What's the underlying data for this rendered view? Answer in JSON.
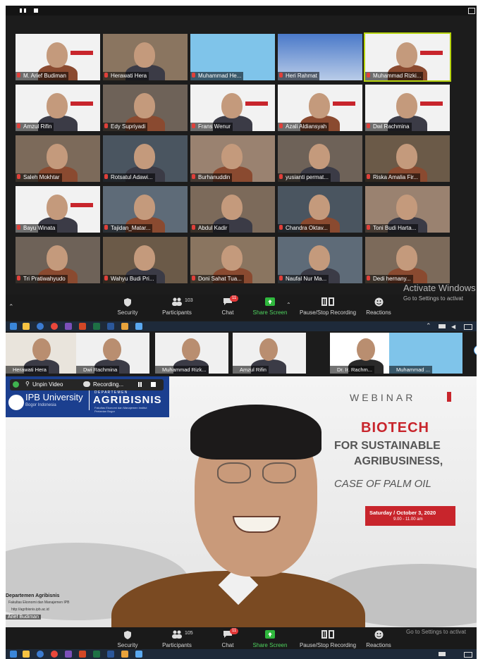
{
  "top_window": {
    "participants": [
      {
        "name": "M. Arief Budiman",
        "type": "slide"
      },
      {
        "name": "Herawati Hera",
        "type": "person"
      },
      {
        "name": "Muhammad He...",
        "type": "blank"
      },
      {
        "name": "Heri Rahmat",
        "type": "logo"
      },
      {
        "name": "Muhammad Rizki...",
        "type": "slide",
        "active": true
      },
      {
        "name": "Amzul Rifin",
        "type": "slide"
      },
      {
        "name": "Edy Supriyadi",
        "type": "person"
      },
      {
        "name": "Frans Wenur",
        "type": "slide"
      },
      {
        "name": "Azali Aldiansyah",
        "type": "slide"
      },
      {
        "name": "Dwi Rachmina",
        "type": "slide"
      },
      {
        "name": "Saleh Mokhtar",
        "type": "person"
      },
      {
        "name": "Rotsatul Adawi...",
        "type": "person"
      },
      {
        "name": "Burhanuddin",
        "type": "person"
      },
      {
        "name": "yusianti permat...",
        "type": "person"
      },
      {
        "name": "Riska Amalia Fir...",
        "type": "person"
      },
      {
        "name": "Bayu Winata",
        "type": "slide"
      },
      {
        "name": "Tajidan_Matar...",
        "type": "person"
      },
      {
        "name": "Abdul Kadir",
        "type": "person"
      },
      {
        "name": "Chandra Oktav...",
        "type": "person"
      },
      {
        "name": "Toni Budi Harta...",
        "type": "person"
      },
      {
        "name": "Tri Pratiwahyudo",
        "type": "person"
      },
      {
        "name": "Wahyu Budi Pri...",
        "type": "person"
      },
      {
        "name": "Doni Sahat Tua...",
        "type": "person"
      },
      {
        "name": "Naufal Nur Ma...",
        "type": "person"
      },
      {
        "name": "Dedi hernany...",
        "type": "person"
      }
    ],
    "toolbar": {
      "security": "Security",
      "participants": "Participants",
      "participants_count": "103",
      "chat": "Chat",
      "chat_badge": "11",
      "share_screen": "Share Screen",
      "recording": "Pause/Stop Recording",
      "reactions": "Reactions"
    },
    "watermark_title": "Activate Windows",
    "watermark_sub": "Go to Settings to activat"
  },
  "bottom_window": {
    "strip": [
      "Herawati Hera",
      "Dwi Rachmina",
      "Muhammad Rizk...",
      "Amzul Rifin",
      "Dr. Ir. Rachm...",
      "Muhammad ..."
    ],
    "unpin_video": "Unpin Video",
    "recording": "Recording...",
    "university": "IPB University",
    "university_sub": "Bogor Indonesia",
    "department_logo": "AGRIBISNIS",
    "department_logo_top": "D E P A R T E M E N",
    "department_logo_sub": "Fakultas Ekonomi dan Manajemen Institut Pertanian Bogor",
    "webinar": "WEBINAR",
    "title_main": "BIOTECH",
    "title_line2": "FOR SUSTAINABLE",
    "title_line3": "AGRIBUSINESS,",
    "title_line4": "CASE OF PALM OIL",
    "date": "Saturday / October 3, 2020",
    "time": "9.00 - 11.00 am",
    "footer_dept": "Departemen Agribisnis",
    "footer_fac": "Fakultas Ekonomi dan Manajemen IPB",
    "footer_web": "http://agribisnis.ipb.ac.id",
    "footer_name": "Arief Budiman",
    "toolbar": {
      "security": "Security",
      "participants": "Participants",
      "participants_count": "105",
      "chat": "Chat",
      "chat_badge": "11",
      "share_screen": "Share Screen",
      "recording": "Pause/Stop Recording",
      "reactions": "Reactions"
    },
    "watermark_sub": "Go to Settings to activat"
  },
  "colors": {
    "accent_red": "#c8252c",
    "ipb_blue": "#1b3f8f",
    "share_green": "#4fd45f"
  }
}
